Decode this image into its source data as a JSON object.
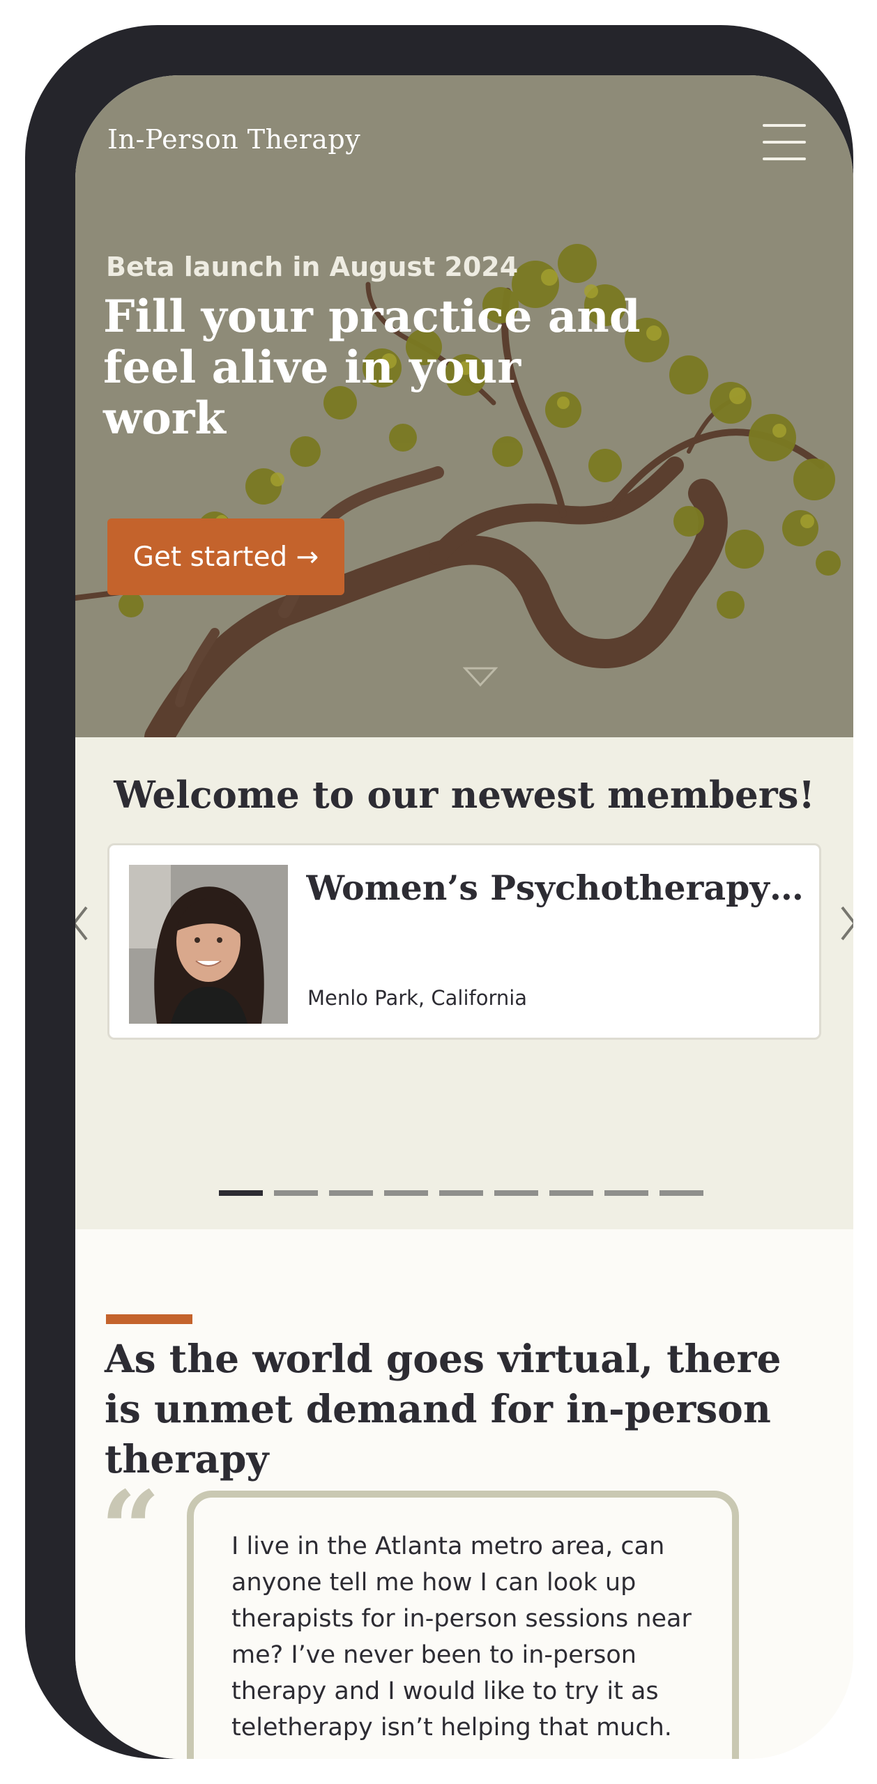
{
  "header": {
    "brand": "In-Person Therapy",
    "menu_icon": "hamburger-menu-icon"
  },
  "hero": {
    "eyebrow": "Beta launch in August 2024",
    "title": "Fill your practice and feel alive in your work",
    "cta_label": "Get started →",
    "scroll_icon": "chevron-down-icon",
    "colors": {
      "background": "#8e8b78",
      "cta": "#c4632c"
    }
  },
  "members": {
    "title": "Welcome to our newest members!",
    "card": {
      "name": "Women’s Psychotherapy &...",
      "location": "Menlo Park, California"
    },
    "prev_icon": "chevron-left-icon",
    "next_icon": "chevron-right-icon",
    "slide_count": 9,
    "active_slide": 1
  },
  "virtual": {
    "title": "As the world goes virtual, there is unmet demand for in-person therapy",
    "quote_mark": "“",
    "quote": "I live in the Atlanta metro area, can anyone tell me how I can look up therapists for in-person sessions near me? I’ve never been to in-person therapy and I would like to try it as teletherapy isn’t helping that much."
  }
}
